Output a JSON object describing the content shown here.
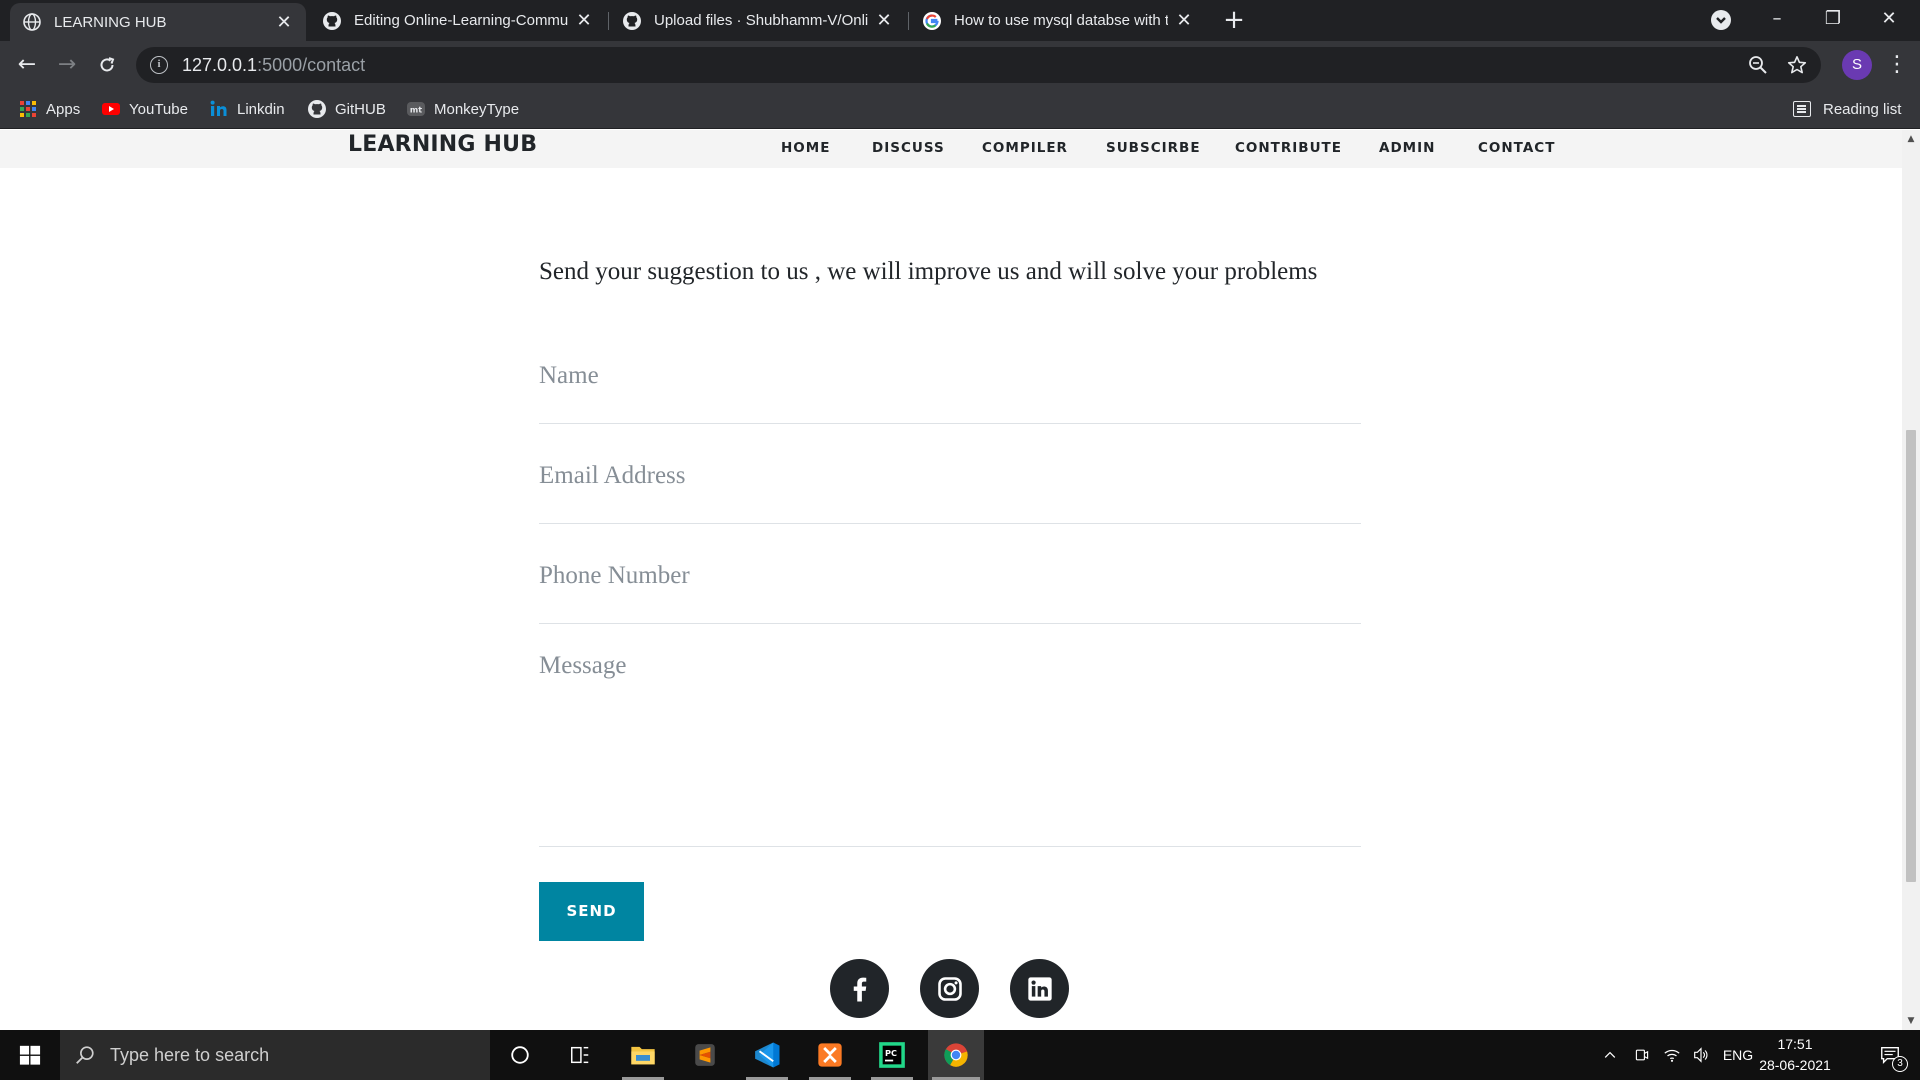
{
  "browser": {
    "tabs": [
      {
        "title": "LEARNING HUB",
        "icon": "globe-icon",
        "active": true
      },
      {
        "title": "Editing Online-Learning-Commun",
        "icon": "github-icon",
        "active": false
      },
      {
        "title": "Upload files · Shubhamm-V/Onli",
        "icon": "github-icon",
        "active": false
      },
      {
        "title": "How to use mysql databse with t",
        "icon": "google-icon",
        "active": false
      }
    ],
    "new_tab_label": "+",
    "url_host": "127.0.0.1",
    "url_path": ":5000/contact",
    "profile_initial": "S",
    "bookmarks": [
      {
        "label": "Apps",
        "icon": "apps-grid-icon"
      },
      {
        "label": "YouTube",
        "icon": "youtube-icon"
      },
      {
        "label": "Linkdin",
        "icon": "linkedin-icon"
      },
      {
        "label": "GitHUB",
        "icon": "github-icon"
      },
      {
        "label": "MonkeyType",
        "icon": "monkeytype-icon"
      }
    ],
    "reading_list_label": "Reading list"
  },
  "site": {
    "brand": "LEARNING HUB",
    "nav": [
      "HOME",
      "DISCUSS",
      "COMPILER",
      "SUBSCIRBE",
      "CONTRIBUTE",
      "ADMIN",
      "CONTACT"
    ],
    "intro": "Send your suggestion to us , we will improve us and will solve your problems",
    "form": {
      "name_placeholder": "Name",
      "email_placeholder": "Email Address",
      "phone_placeholder": "Phone Number",
      "message_placeholder": "Message",
      "send_label": "SEND"
    },
    "social": [
      "facebook-icon",
      "instagram-icon",
      "linkedin-icon"
    ]
  },
  "taskbar": {
    "search_placeholder": "Type here to search",
    "apps": [
      "cortana-icon",
      "task-view-icon",
      "file-explorer-icon",
      "sublime-text-icon",
      "vscode-icon",
      "xampp-icon",
      "pycharm-icon",
      "chrome-icon"
    ],
    "language": "ENG",
    "time": "17:51",
    "date": "28-06-2021",
    "notification_count": "3"
  },
  "colors": {
    "accent": "#0085a1",
    "chrome_dark": "#202124",
    "chrome_mid": "#35363a"
  }
}
